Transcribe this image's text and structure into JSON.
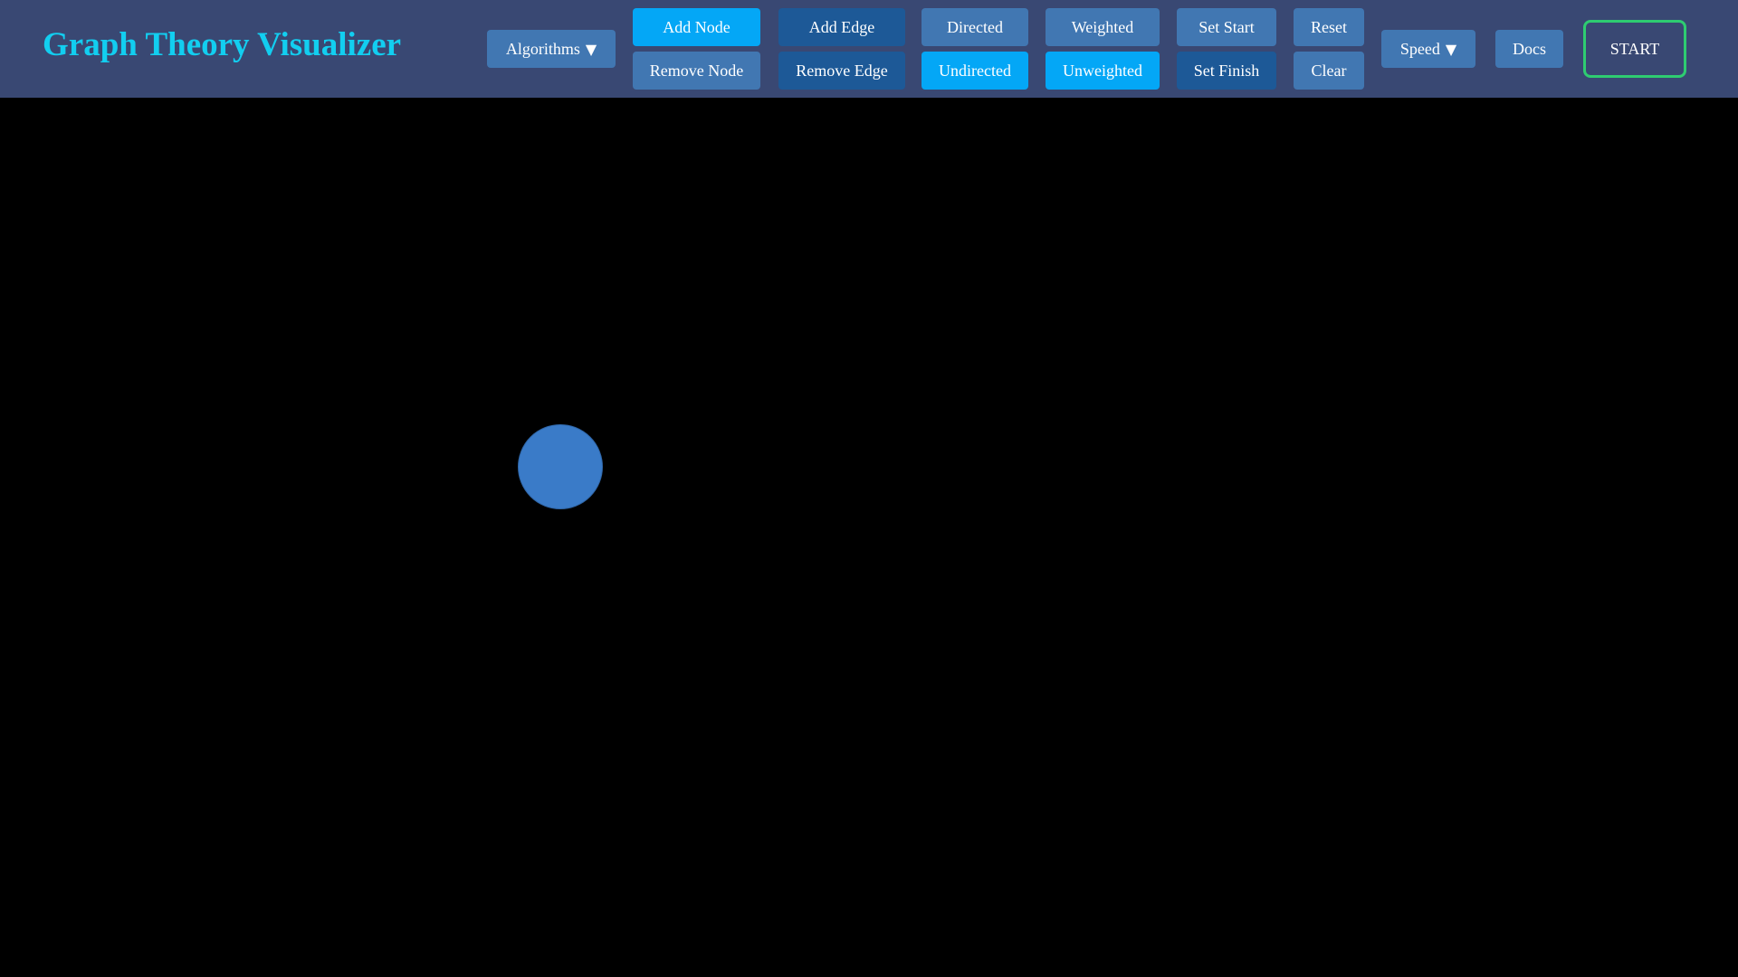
{
  "app": {
    "title": "Graph Theory Visualizer"
  },
  "toolbar": {
    "algorithms": {
      "label": "Algorithms",
      "caret": "▼"
    },
    "add_node": "Add Node",
    "remove_node": "Remove Node",
    "add_edge": "Add Edge",
    "remove_edge": "Remove Edge",
    "directed": "Directed",
    "undirected": "Undirected",
    "weighted": "Weighted",
    "unweighted": "Unweighted",
    "set_start": "Set Start",
    "set_finish": "Set Finish",
    "reset": "Reset",
    "clear": "Clear",
    "speed": {
      "label": "Speed",
      "caret": "▼"
    },
    "docs": "Docs",
    "start": "START"
  },
  "state": {
    "active_mode": "Add Node",
    "edge_direction": "Undirected",
    "edge_weighting": "Unweighted"
  },
  "colors": {
    "navbar": "#394873",
    "brand": "#12cef0",
    "button": "#4177b2",
    "button_active": "#04a7f6",
    "button_dark": "#1d5997",
    "start_border": "#2ecc71",
    "canvas": "#000000",
    "node": "#3a7bc8"
  },
  "canvas": {
    "node_count": 1
  }
}
